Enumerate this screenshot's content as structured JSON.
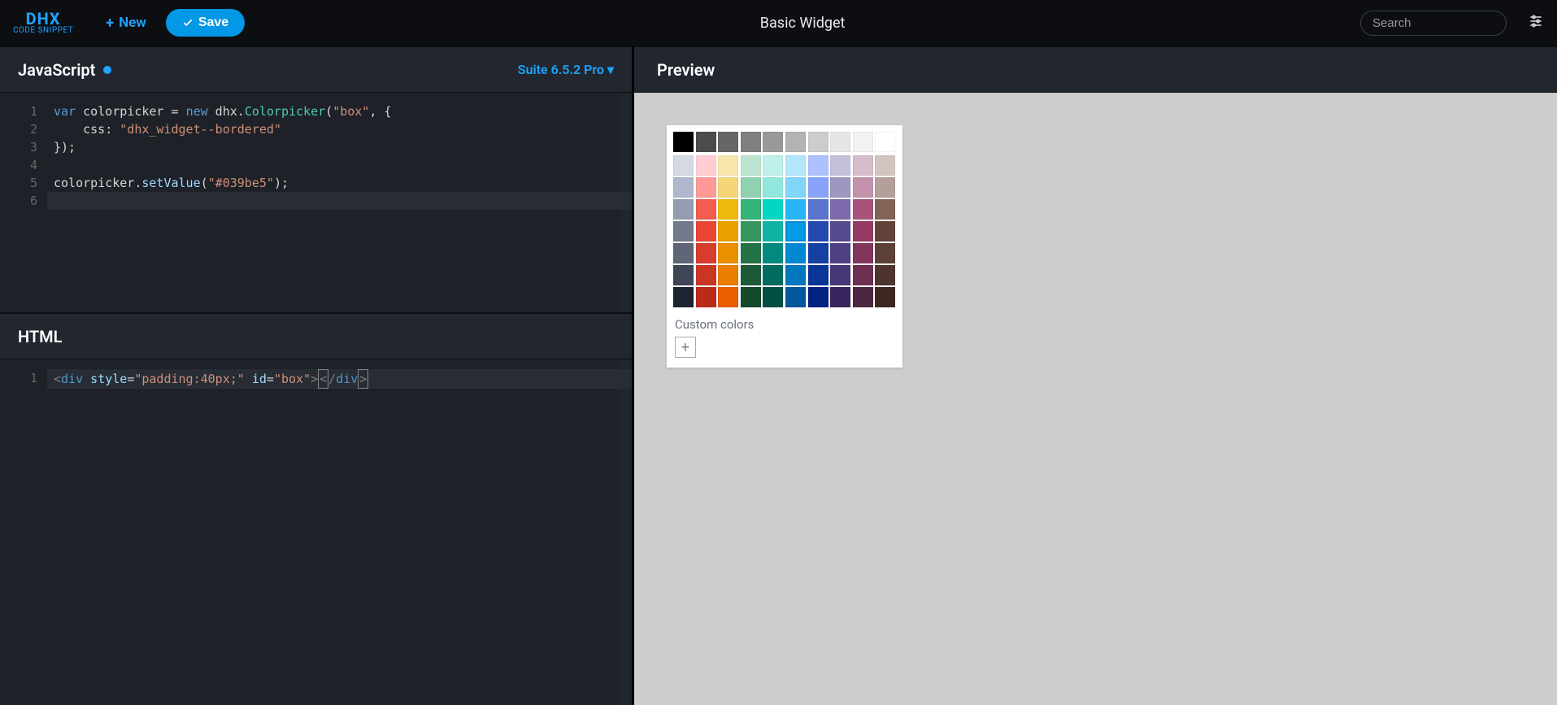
{
  "header": {
    "logo_top": "DHX",
    "logo_bottom": "CODE SNIPPET",
    "new_label": "New",
    "save_label": "Save",
    "title": "Basic Widget",
    "search_placeholder": "Search"
  },
  "panels": {
    "js_title": "JavaScript",
    "version_label": "Suite 6.5.2 Pro",
    "html_title": "HTML",
    "preview_title": "Preview"
  },
  "code_js": {
    "line_numbers": [
      "1",
      "2",
      "3",
      "4",
      "5",
      "6"
    ],
    "l1_var": "var",
    "l1_ident": " colorpicker ",
    "l1_eq": "= ",
    "l1_new": "new",
    "l1_dhx": " dhx.",
    "l1_cls": "Colorpicker",
    "l1_open": "(",
    "l1_str": "\"box\"",
    "l1_comma": ", {",
    "l2_indent": "    css: ",
    "l2_str": "\"dhx_widget--bordered\"",
    "l3": "});",
    "l5_a": "colorpicker.",
    "l5_b": "setValue",
    "l5_c": "(",
    "l5_str": "\"#039be5\"",
    "l5_d": ");"
  },
  "code_html": {
    "line_numbers": [
      "1"
    ],
    "lt": "<",
    "div": "div",
    "sp": " ",
    "style_attr": "style",
    "eq": "=",
    "style_val": "\"padding:40px;\"",
    "id_attr": "id",
    "id_val": "\"box\"",
    "gt": ">",
    "lts": "<",
    "slash": "/",
    "gte": ">"
  },
  "colorpicker": {
    "custom_label": "Custom colors",
    "selected": "#039be5",
    "grays": [
      "#000000",
      "#4c4c4c",
      "#666666",
      "#808080",
      "#999999",
      "#b3b3b3",
      "#cccccc",
      "#e6e6e6",
      "#f2f2f2",
      "#ffffff"
    ],
    "rows": [
      [
        "#d4dae4",
        "#ffcdd2",
        "#f9e6ad",
        "#bce4ce",
        "#bdf0e9",
        "#b3e5fc",
        "#aec1ff",
        "#c5c0da",
        "#d6bdcc",
        "#d2c5c1"
      ],
      [
        "#b0b8cd",
        "#fe9998",
        "#f4d679",
        "#90d2af",
        "#92e7dc",
        "#81d4fa",
        "#88a3f9",
        "#9f97c1",
        "#c492ac",
        "#b4a09a"
      ],
      [
        "#949db1",
        "#f35c4e",
        "#edb90f",
        "#33b579",
        "#02d7c5",
        "#29b6f6",
        "#5874cd",
        "#7e6bad",
        "#a9537c",
        "#826358"
      ],
      [
        "#727a8c",
        "#e94633",
        "#eaa100",
        "#36955f",
        "#11b3a5",
        "#039be5",
        "#2349ae",
        "#584a8f",
        "#963a64",
        "#624339"
      ],
      [
        "#5e6677",
        "#d73c2d",
        "#ea8f00",
        "#247346",
        "#018b80",
        "#0288d1",
        "#163fa2",
        "#4f4083",
        "#81355a",
        "#5d4037"
      ],
      [
        "#3f4757",
        "#ca3626",
        "#ea7e00",
        "#1d5b38",
        "#026b60",
        "#0277bd",
        "#083596",
        "#473776",
        "#6e3051",
        "#4e342e"
      ],
      [
        "#1d2534",
        "#bb2b1a",
        "#ea5d00",
        "#17492d",
        "#024f43",
        "#01579b",
        "#002381",
        "#3a265f",
        "#4c2640",
        "#3e2723"
      ]
    ]
  }
}
